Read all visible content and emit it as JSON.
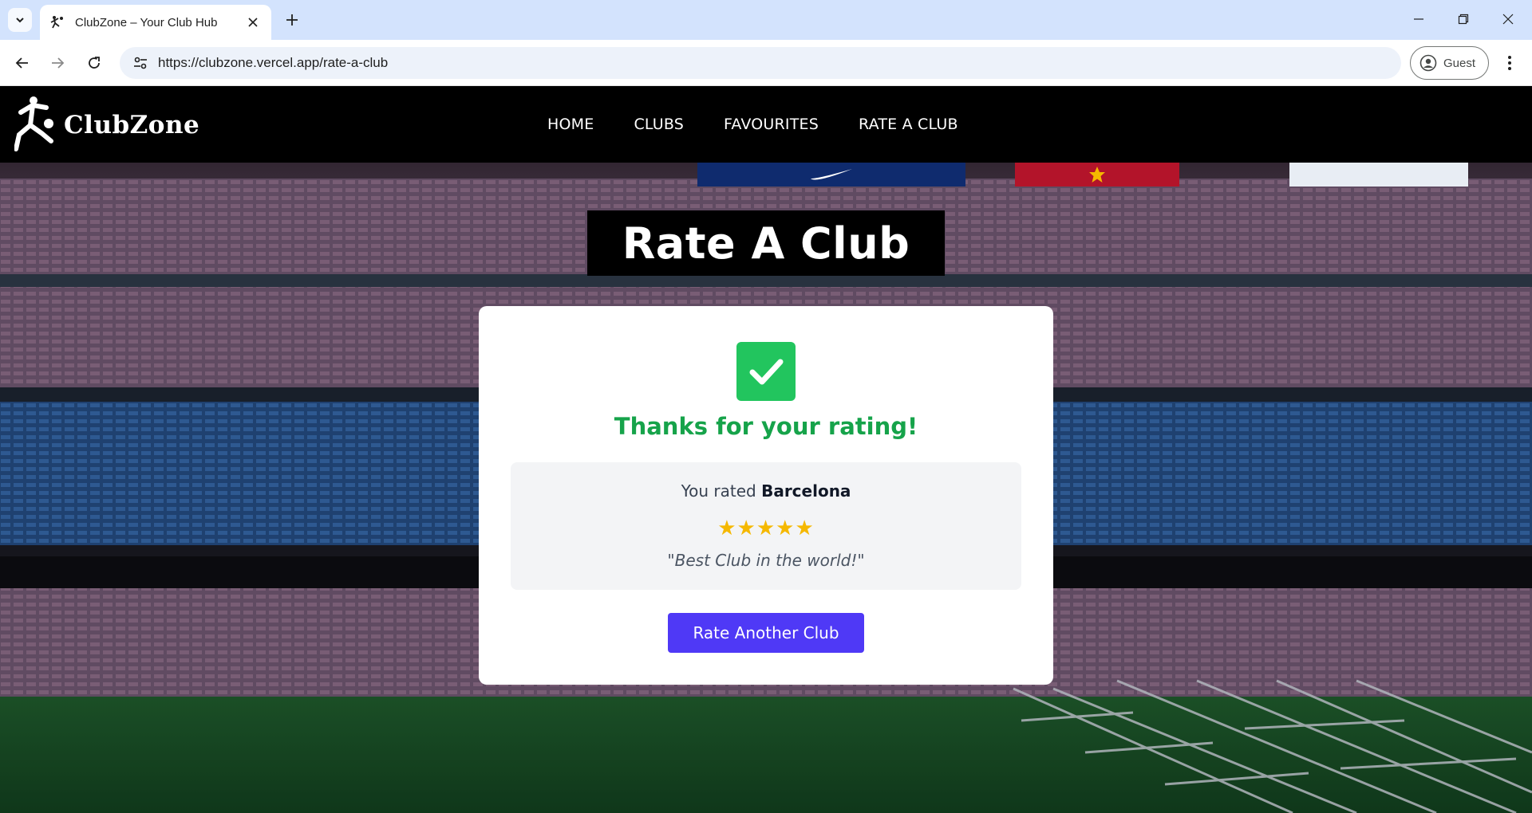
{
  "browser": {
    "tab_title": "ClubZone – Your Club Hub",
    "url": "https://clubzone.vercel.app/rate-a-club",
    "profile_label": "Guest"
  },
  "site": {
    "brand": "ClubZone",
    "nav": [
      {
        "label": "HOME"
      },
      {
        "label": "CLUBS"
      },
      {
        "label": "FAVOURITES"
      },
      {
        "label": "RATE A CLUB"
      }
    ]
  },
  "page": {
    "title": "Rate A Club",
    "success_message": "Thanks for your rating!",
    "rated_prefix": "You rated",
    "club_name": "Barcelona",
    "rating": 5,
    "rating_max": 5,
    "stars": "★★★★★",
    "comment": "\"Best Club in the world!\"",
    "button_label": "Rate Another Club"
  },
  "colors": {
    "accent_button": "#4f39f6",
    "success_green": "#16a34a",
    "check_green": "#22c55e",
    "star_gold": "#f5b800"
  },
  "icons": {
    "tab_menu": "chevron-down-icon",
    "favicon": "player-kick-icon",
    "tab_close": "close-icon",
    "new_tab": "plus-icon",
    "back": "arrow-left-icon",
    "forward": "arrow-right-icon",
    "reload": "reload-icon",
    "site_info": "tune-icon",
    "profile": "person-icon",
    "menu": "kebab-icon",
    "success": "check-icon"
  }
}
